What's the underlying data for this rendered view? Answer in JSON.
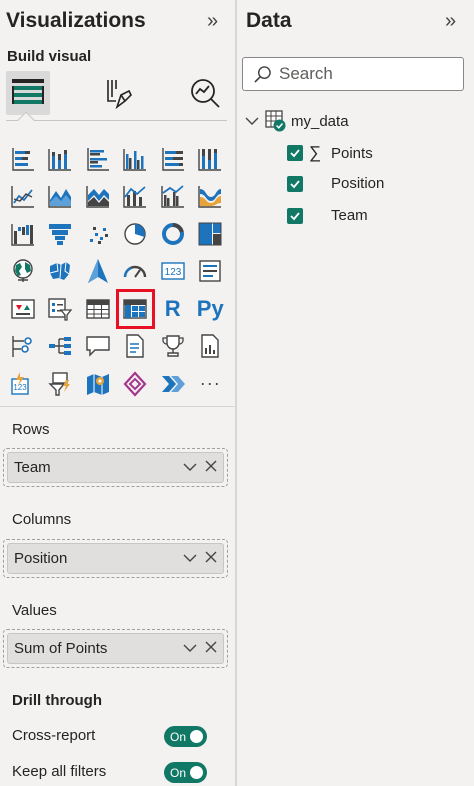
{
  "visualizations": {
    "title": "Visualizations",
    "collapse_icon": "»",
    "build_visual_label": "Build visual",
    "modes": [
      {
        "name": "build-visual-icon"
      },
      {
        "name": "format-visual-icon"
      },
      {
        "name": "analytics-icon"
      }
    ],
    "gallery": [
      "stacked-bar-chart",
      "stacked-column-chart",
      "clustered-bar-chart",
      "clustered-column-chart",
      "100-stacked-bar-chart",
      "100-stacked-column-chart",
      "line-chart",
      "area-chart",
      "stacked-area-chart",
      "line-and-stacked-column-chart",
      "line-and-clustered-column-chart",
      "ribbon-chart",
      "waterfall-chart",
      "funnel-chart",
      "scatter-chart",
      "pie-chart",
      "donut-chart",
      "treemap",
      "map",
      "filled-map",
      "azure-map",
      "gauge",
      "card",
      "multi-row-card",
      "kpi",
      "slicer",
      "table",
      "matrix",
      "r-script-visual",
      "python-visual",
      "key-influencers",
      "decomposition-tree",
      "qa-visual",
      "smart-narrative",
      "metrics-visual",
      "paginated-report",
      "power-apps",
      "power-automate",
      "arcgis-maps",
      "azure-maps-visual",
      "power-automate-flow",
      "more-visuals"
    ],
    "r_label": "R",
    "py_label": "Py",
    "card_label": "123",
    "more_label": "···",
    "selected_visual": "matrix"
  },
  "wells": {
    "rows": {
      "label": "Rows",
      "field": "Team"
    },
    "columns": {
      "label": "Columns",
      "field": "Position"
    },
    "values": {
      "label": "Values",
      "field": "Sum of Points"
    }
  },
  "drill_through": {
    "title": "Drill through",
    "cross_report": {
      "label": "Cross-report",
      "state": "On"
    },
    "keep_all_filters": {
      "label": "Keep all filters",
      "state": "On"
    }
  },
  "data_pane": {
    "title": "Data",
    "collapse_icon": "»",
    "search_placeholder": "Search",
    "table_name": "my_data",
    "sigma_symbol": "∑",
    "fields": [
      {
        "name": "Points",
        "checked": true,
        "aggregate": true
      },
      {
        "name": "Position",
        "checked": true,
        "aggregate": false
      },
      {
        "name": "Team",
        "checked": true,
        "aggregate": false
      }
    ]
  },
  "colors": {
    "accent_teal": "#117865",
    "icon_blue": "#1d74bc",
    "selection_red": "#e81123"
  }
}
